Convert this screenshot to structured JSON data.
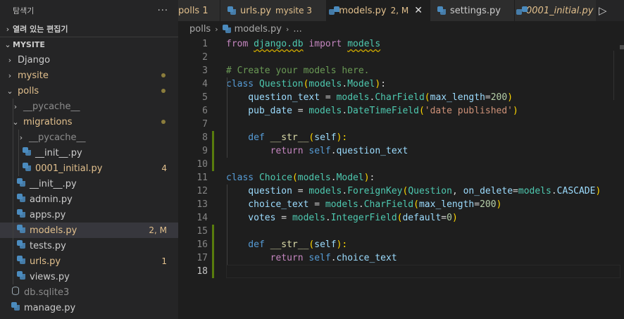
{
  "explorer": {
    "title": "탐색기",
    "more": "···",
    "open_editors": "열려 있는 편집기",
    "workspace": "MYSITE"
  },
  "tree": [
    {
      "label": "Django",
      "kind": "folder",
      "indent": 0,
      "open": false,
      "color": "#cccccc"
    },
    {
      "label": "mysite",
      "kind": "folder",
      "indent": 0,
      "open": false,
      "color": "#e2c08d",
      "dot": "#8b7d3c"
    },
    {
      "label": "polls",
      "kind": "folder",
      "indent": 0,
      "open": true,
      "color": "#e2c08d",
      "dot": "#8b7d3c"
    },
    {
      "label": "__pycache__",
      "kind": "folder",
      "indent": 1,
      "open": false,
      "color": "#8c8c8c"
    },
    {
      "label": "migrations",
      "kind": "folder",
      "indent": 1,
      "open": true,
      "color": "#e2c08d",
      "dot": "#8b7d3c"
    },
    {
      "label": "__pycache__",
      "kind": "folder",
      "indent": 2,
      "open": false,
      "color": "#8c8c8c"
    },
    {
      "label": "__init__.py",
      "kind": "py",
      "indent": 2,
      "color": "#cccccc"
    },
    {
      "label": "0001_initial.py",
      "kind": "py",
      "indent": 2,
      "color": "#e2c08d",
      "badge": "4",
      "badge_color": "#e2c08d"
    },
    {
      "label": "__init__.py",
      "kind": "py",
      "indent": 1,
      "color": "#cccccc"
    },
    {
      "label": "admin.py",
      "kind": "py",
      "indent": 1,
      "color": "#cccccc"
    },
    {
      "label": "apps.py",
      "kind": "py",
      "indent": 1,
      "color": "#cccccc"
    },
    {
      "label": "models.py",
      "kind": "py",
      "indent": 1,
      "color": "#e2c08d",
      "badge": "2, M",
      "badge_color": "#e2c08d",
      "selected": true
    },
    {
      "label": "tests.py",
      "kind": "py",
      "indent": 1,
      "color": "#cccccc"
    },
    {
      "label": "urls.py",
      "kind": "py",
      "indent": 1,
      "color": "#e2c08d",
      "badge": "1",
      "badge_color": "#e2c08d"
    },
    {
      "label": "views.py",
      "kind": "py",
      "indent": 1,
      "color": "#cccccc"
    },
    {
      "label": "db.sqlite3",
      "kind": "db",
      "indent": 0,
      "color": "#8c8c8c"
    },
    {
      "label": "manage.py",
      "kind": "py",
      "indent": 0,
      "color": "#cccccc"
    }
  ],
  "tabs": [
    {
      "label": "polls 1",
      "color": "#e2c08d",
      "desc": "",
      "active": false,
      "icon": false
    },
    {
      "label": "urls.py",
      "color": "#e2c08d",
      "desc": "mysite 3",
      "active": false,
      "icon": true
    },
    {
      "label": "models.py",
      "color": "#e2c08d",
      "desc": "2, M",
      "active": true,
      "icon": true,
      "close": "✕"
    },
    {
      "label": "settings.py",
      "color": "#cccccc",
      "desc": "",
      "active": false,
      "icon": true
    },
    {
      "label": "0001_initial.py",
      "color": "#e2c08d",
      "desc": "",
      "active": false,
      "icon": true,
      "italic": true
    }
  ],
  "run_icon": "▷",
  "breadcrumb": {
    "folder": "polls",
    "file": "models.py",
    "more": "..."
  },
  "editor": {
    "current_line": 18,
    "modified_lines": [
      8,
      9,
      10,
      15,
      16,
      17,
      18
    ],
    "lines": [
      [
        [
          "from ",
          "t-kw2"
        ],
        [
          "django.db",
          "t-cls squig"
        ],
        [
          " ",
          "t-op"
        ],
        [
          "import",
          "t-kw2"
        ],
        [
          " ",
          "t-op"
        ],
        [
          "models",
          "t-cls squig"
        ]
      ],
      [],
      [
        [
          "# Create your models here.",
          "t-com"
        ]
      ],
      [
        [
          "class ",
          "t-kw"
        ],
        [
          "Question",
          "t-cls"
        ],
        [
          "(",
          "t-br1"
        ],
        [
          "models",
          "t-cls"
        ],
        [
          ".",
          "t-op"
        ],
        [
          "Model",
          "t-cls"
        ],
        [
          ")",
          "t-br1"
        ],
        [
          ":",
          "t-op"
        ]
      ],
      [
        [
          "    question_text",
          "t-var"
        ],
        [
          " = ",
          "t-op"
        ],
        [
          "models",
          "t-cls"
        ],
        [
          ".",
          "t-op"
        ],
        [
          "CharField",
          "t-cls"
        ],
        [
          "(",
          "t-br1"
        ],
        [
          "max_length",
          "t-var"
        ],
        [
          "=",
          "t-op"
        ],
        [
          "200",
          "t-num"
        ],
        [
          ")",
          "t-br1"
        ]
      ],
      [
        [
          "    pub_date",
          "t-var"
        ],
        [
          " = ",
          "t-op"
        ],
        [
          "models",
          "t-cls"
        ],
        [
          ".",
          "t-op"
        ],
        [
          "DateTimeField",
          "t-cls"
        ],
        [
          "(",
          "t-br1"
        ],
        [
          "'date published'",
          "t-str"
        ],
        [
          ")",
          "t-br1"
        ]
      ],
      [],
      [
        [
          "    def ",
          "t-kw"
        ],
        [
          "__str__",
          "t-fn"
        ],
        [
          "(",
          "t-br1"
        ],
        [
          "self",
          "t-var"
        ],
        [
          "):",
          "t-br1"
        ]
      ],
      [
        [
          "        return ",
          "t-kw2"
        ],
        [
          "self",
          "t-self"
        ],
        [
          ".",
          "t-op"
        ],
        [
          "question_text",
          "t-var"
        ]
      ],
      [],
      [
        [
          "class ",
          "t-kw"
        ],
        [
          "Choice",
          "t-cls"
        ],
        [
          "(",
          "t-br1"
        ],
        [
          "models",
          "t-cls"
        ],
        [
          ".",
          "t-op"
        ],
        [
          "Model",
          "t-cls"
        ],
        [
          ")",
          "t-br1"
        ],
        [
          ":",
          "t-op"
        ]
      ],
      [
        [
          "    question",
          "t-var"
        ],
        [
          " = ",
          "t-op"
        ],
        [
          "models",
          "t-cls"
        ],
        [
          ".",
          "t-op"
        ],
        [
          "ForeignKey",
          "t-cls"
        ],
        [
          "(",
          "t-br1"
        ],
        [
          "Question",
          "t-cls"
        ],
        [
          ", ",
          "t-op"
        ],
        [
          "on_delete",
          "t-var"
        ],
        [
          "=",
          "t-op"
        ],
        [
          "models",
          "t-cls"
        ],
        [
          ".",
          "t-op"
        ],
        [
          "CASCADE",
          "t-var"
        ],
        [
          ")",
          "t-br1"
        ]
      ],
      [
        [
          "    choice_text",
          "t-var"
        ],
        [
          " = ",
          "t-op"
        ],
        [
          "models",
          "t-cls"
        ],
        [
          ".",
          "t-op"
        ],
        [
          "CharField",
          "t-cls"
        ],
        [
          "(",
          "t-br1"
        ],
        [
          "max_length",
          "t-var"
        ],
        [
          "=",
          "t-op"
        ],
        [
          "200",
          "t-num"
        ],
        [
          ")",
          "t-br1"
        ]
      ],
      [
        [
          "    votes",
          "t-var"
        ],
        [
          " = ",
          "t-op"
        ],
        [
          "models",
          "t-cls"
        ],
        [
          ".",
          "t-op"
        ],
        [
          "IntegerField",
          "t-cls"
        ],
        [
          "(",
          "t-br1"
        ],
        [
          "default",
          "t-var"
        ],
        [
          "=",
          "t-op"
        ],
        [
          "0",
          "t-num"
        ],
        [
          ")",
          "t-br1"
        ]
      ],
      [],
      [
        [
          "    def ",
          "t-kw"
        ],
        [
          "__str__",
          "t-fn"
        ],
        [
          "(",
          "t-br1"
        ],
        [
          "self",
          "t-var"
        ],
        [
          "):",
          "t-br1"
        ]
      ],
      [
        [
          "        return ",
          "t-kw2"
        ],
        [
          "self",
          "t-self"
        ],
        [
          ".",
          "t-op"
        ],
        [
          "choice_text",
          "t-var"
        ]
      ],
      []
    ]
  }
}
